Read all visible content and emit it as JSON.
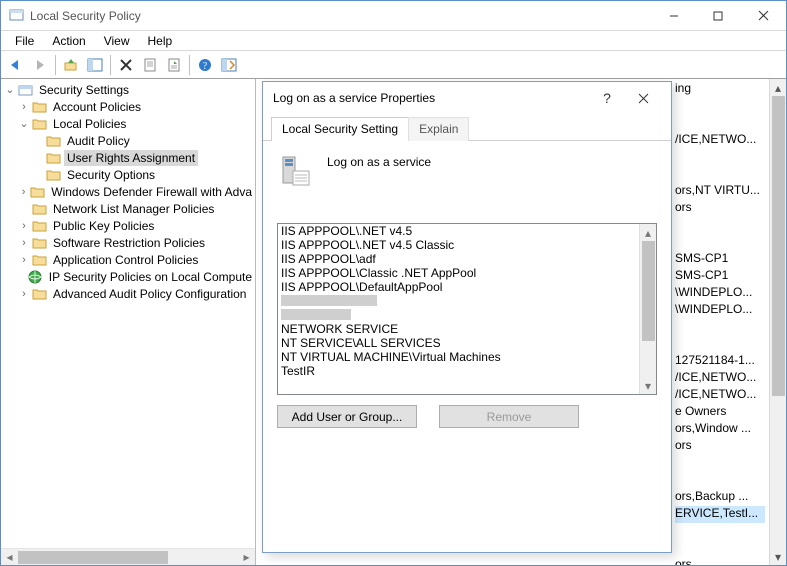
{
  "window": {
    "title": "Local Security Policy"
  },
  "menu": {
    "file": "File",
    "action": "Action",
    "view": "View",
    "help": "Help"
  },
  "tree": {
    "root": "Security Settings",
    "items": [
      {
        "label": "Account Policies",
        "exp": ">"
      },
      {
        "label": "Local Policies",
        "exp": "v",
        "children": [
          {
            "label": "Audit Policy"
          },
          {
            "label": "User Rights Assignment",
            "selected": true
          },
          {
            "label": "Security Options"
          }
        ]
      },
      {
        "label": "Windows Defender Firewall with Adva",
        "exp": ">"
      },
      {
        "label": "Network List Manager Policies"
      },
      {
        "label": "Public Key Policies",
        "exp": ">"
      },
      {
        "label": "Software Restriction Policies",
        "exp": ">"
      },
      {
        "label": "Application Control Policies",
        "exp": ">"
      },
      {
        "label": "IP Security Policies on Local Compute",
        "icon": "globe"
      },
      {
        "label": "Advanced Audit Policy Configuration",
        "exp": ">"
      }
    ]
  },
  "right_column": {
    "header": "ing",
    "rows": [
      "",
      "",
      "/ICE,NETWO...",
      "",
      "",
      "ors,NT VIRTU...",
      "ors",
      "",
      "",
      "SMS-CP1",
      "SMS-CP1",
      "\\WINDEPLO...",
      "\\WINDEPLO...",
      "",
      "",
      "127521184-1...",
      "/ICE,NETWO...",
      "/ICE,NETWO...",
      "e Owners",
      "ors,Window ...",
      "ors",
      "",
      "",
      "ors,Backup ...",
      "ERVICE,TestI...",
      "",
      "",
      "ors"
    ],
    "selected_index": 24
  },
  "dialog": {
    "title": "Log on as a service Properties",
    "tabs": {
      "active": "Local Security Setting",
      "inactive": "Explain"
    },
    "heading": "Log on as a service",
    "list": [
      "IIS APPPOOL\\.NET v4.5",
      "IIS APPPOOL\\.NET v4.5 Classic",
      "IIS APPPOOL\\adf",
      "IIS APPPOOL\\Classic .NET AppPool",
      "IIS APPPOOL\\DefaultAppPool",
      "",
      "",
      "NETWORK SERVICE",
      "NT SERVICE\\ALL SERVICES",
      "NT VIRTUAL MACHINE\\Virtual Machines",
      "TestIR"
    ],
    "redacted_widths": [
      96,
      70
    ],
    "buttons": {
      "add": "Add User or Group...",
      "remove": "Remove"
    }
  }
}
